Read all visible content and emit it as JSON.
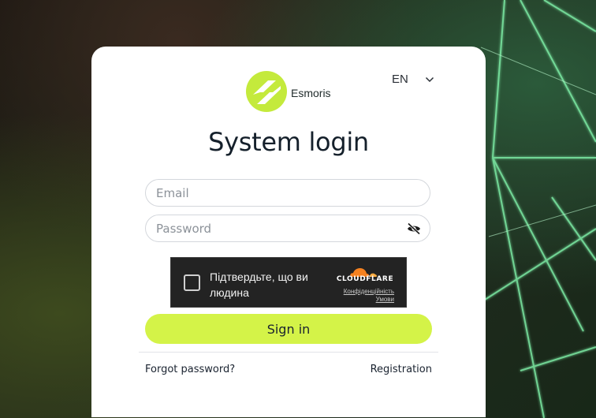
{
  "brand": {
    "name": "Esmoris",
    "accent_color": "#d4f348",
    "logo_icon": "esmoris-logo-icon"
  },
  "language": {
    "selected": "EN",
    "icon": "chevron-down-icon"
  },
  "login": {
    "title": "System login",
    "email_placeholder": "Email",
    "password_placeholder": "Password",
    "password_toggle_icon": "eye-slash-icon",
    "sign_in_label": "Sign in",
    "forgot_password_label": "Forgot password?",
    "registration_label": "Registration"
  },
  "captcha": {
    "prompt": "Підтвердьте, що ви людина",
    "provider": "CLOUDFLARE",
    "privacy_link": "Конфіденційність",
    "terms_link": "Умови",
    "background_color": "#232323",
    "logo_color": "#f48120"
  }
}
